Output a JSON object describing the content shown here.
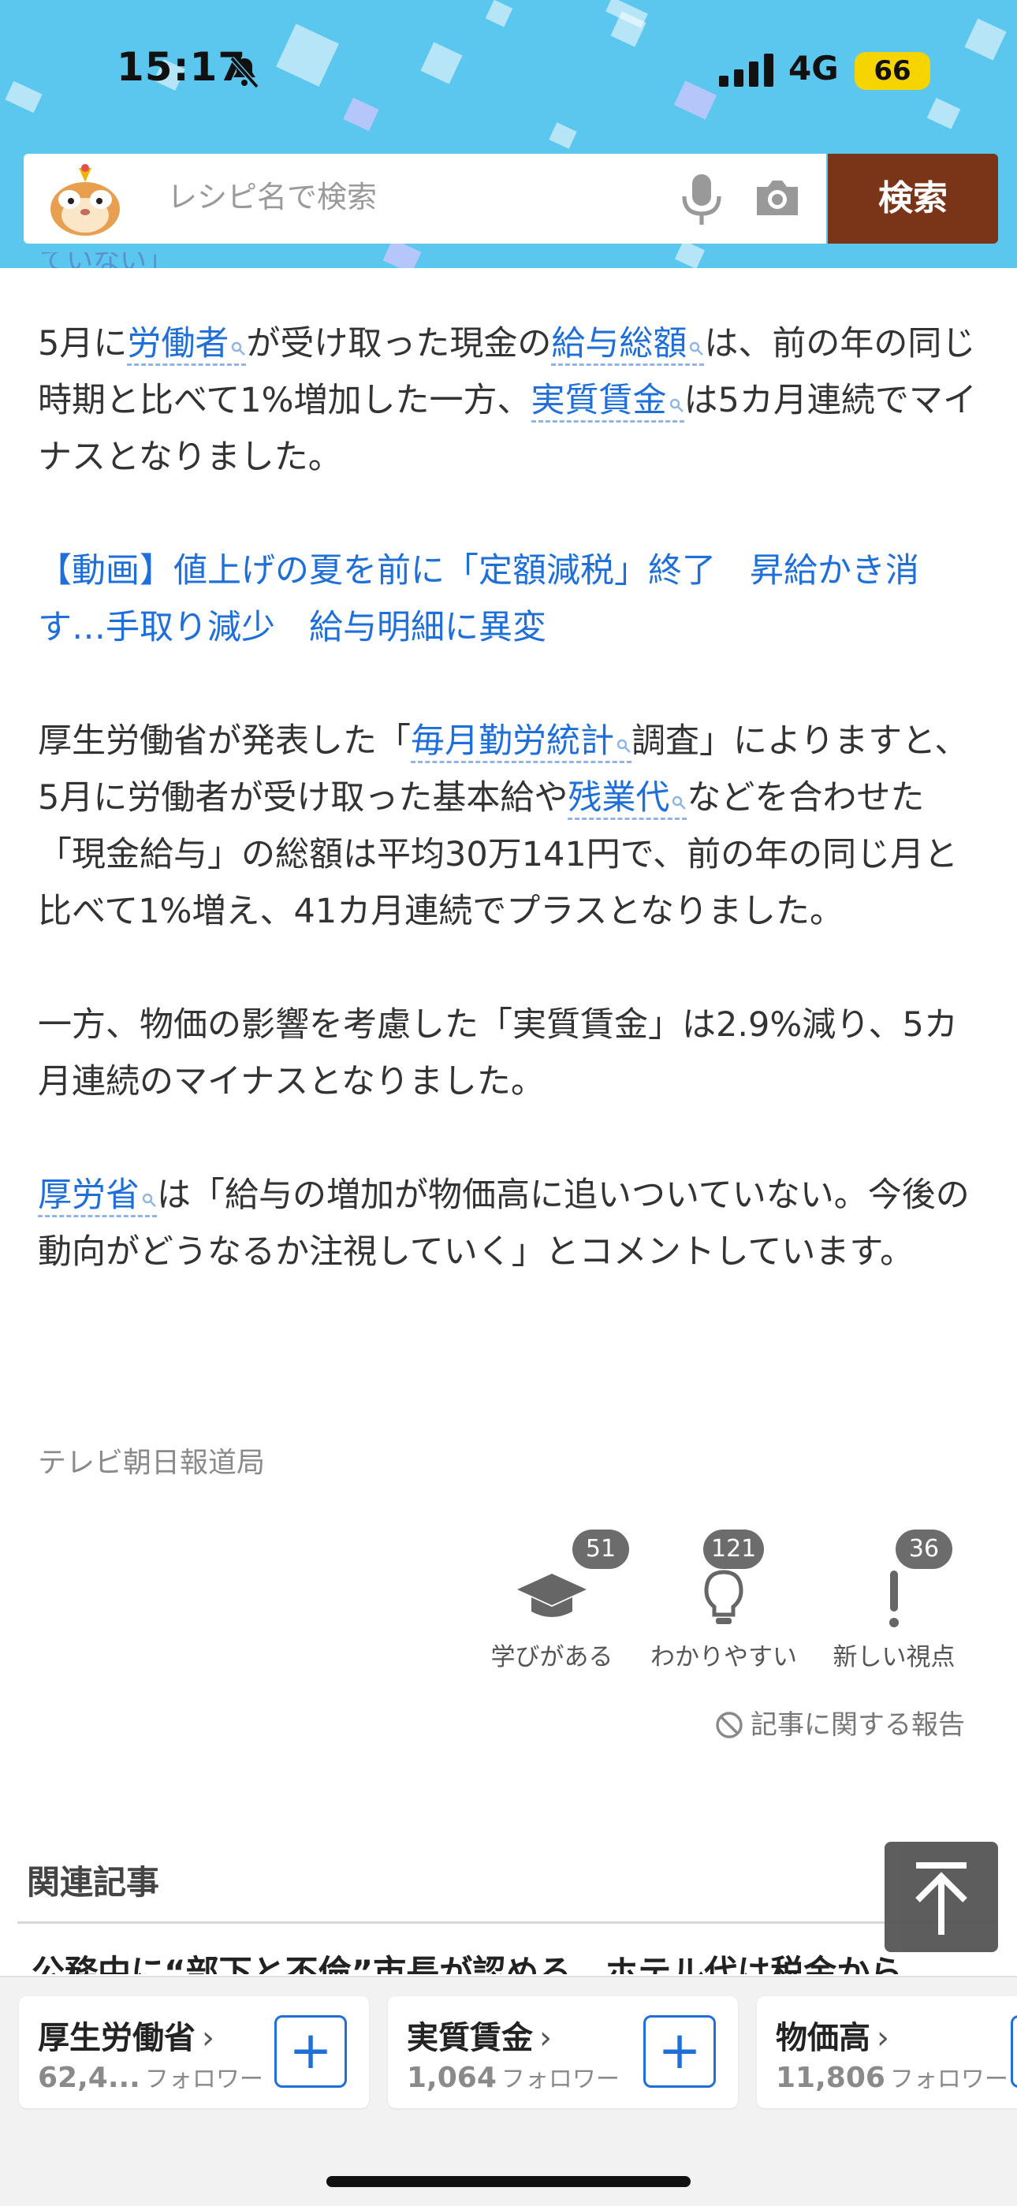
{
  "status": {
    "time": "15:17",
    "network": "4G",
    "battery": "66"
  },
  "search": {
    "placeholder": "レシピ名で検索",
    "button_label": "検索"
  },
  "article": {
    "cut_top_text": "ていない」",
    "p1": {
      "t1": "5月に",
      "k1": "労働者",
      "t2": "が受け取った現金の",
      "k2": "給与総額",
      "t3": "は、前の年の同じ時期と比べて1%増加した一方、",
      "k3": "実質賃金",
      "t4": "は5カ月連続でマイナスとなりました。"
    },
    "video_link": "【動画】値上げの夏を前に「定額減税」終了　昇給かき消す…手取り減少　給与明細に異変",
    "p2": {
      "t1": "厚生労働省が発表した「",
      "k1": "毎月勤労統計",
      "t2": "調査」によりますと、5月に労働者が受け取った基本給や",
      "k2": "残業代",
      "t3": "などを合わせた「現金給与」の総額は平均30万141円で、前の年の同じ月と比べて1%増え、41カ月連続でプラスとなりました。"
    },
    "p3": "一方、物価の影響を考慮した「実質賃金」は2.9%減り、5カ月連続のマイナスとなりました。",
    "p4": {
      "k1": "厚労省",
      "t1": "は「給与の増加が物価高に追いついていない。今後の動向がどうなるか注視していく」とコメントしています。"
    },
    "source": "テレビ朝日報道局"
  },
  "reactions": [
    {
      "label": "学びがある",
      "count": "51",
      "icon": "graduation-cap-icon"
    },
    {
      "label": "わかりやすい",
      "count": "121",
      "icon": "lightbulb-icon"
    },
    {
      "label": "新しい視点",
      "count": "36",
      "icon": "exclamation-icon"
    }
  ],
  "report_label": "記事に関する報告",
  "related": {
    "title": "関連記事",
    "first_item": "公務中に“部下と不倫”市長が認める　ホテル代は税金から"
  },
  "follow_topics": [
    {
      "name": "厚生労働省",
      "count": "62,4...",
      "unit": "フォロワー"
    },
    {
      "name": "実質賃金",
      "count": "1,064",
      "unit": "フォロワー"
    },
    {
      "name": "物価高",
      "count": "11,806",
      "unit": "フォロワー"
    }
  ],
  "colors": {
    "header": "#5bc6ee",
    "search_button": "#7a3418",
    "link": "#1e6fd9",
    "battery": "#f5d400"
  }
}
